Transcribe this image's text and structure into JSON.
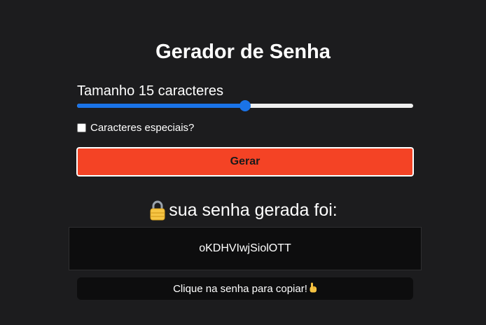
{
  "title": "Gerador de Senha",
  "length": {
    "label": "Tamanho 15 caracteres",
    "value": 15,
    "slider_fraction": 0.5
  },
  "special_chars": {
    "label": "Caracteres especiais?",
    "checked": false
  },
  "generate_button": {
    "label": "Gerar"
  },
  "result": {
    "heading": "sua senha gerada foi:",
    "heading_icon": "lock-icon",
    "password": "oKDHVIwjSiolOTT"
  },
  "copy_hint": {
    "text": "Clique na senha para copiar!",
    "icon": "pointing-hand-icon"
  },
  "colors": {
    "background": "#1c1c1e",
    "button": "#f44325",
    "slider_accent": "#1a73e8",
    "panel": "#0d0d0e"
  }
}
